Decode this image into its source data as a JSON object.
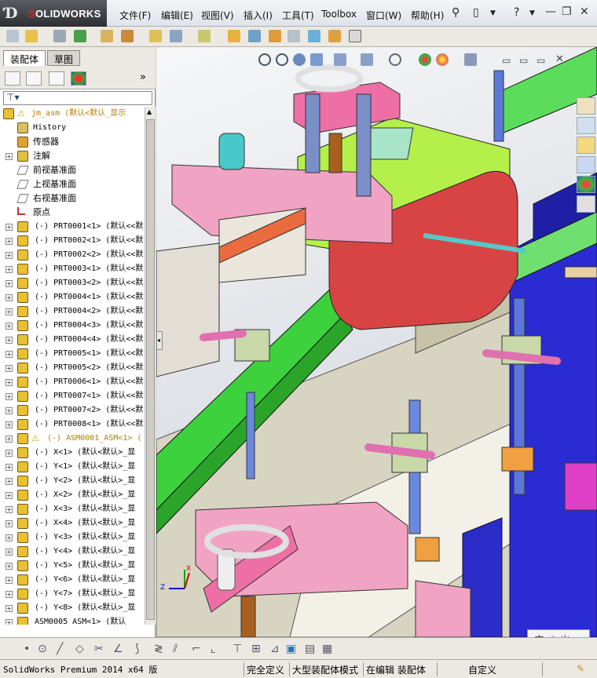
{
  "app": {
    "brand": "SOLIDWORKS",
    "menu": [
      "文件(F)",
      "编辑(E)",
      "视图(V)",
      "插入(I)",
      "工具(T)",
      "Toolbox",
      "窗口(W)",
      "帮助(H)"
    ],
    "accent": "#d42a2a"
  },
  "panel": {
    "tabs": [
      "装配体",
      "草图"
    ],
    "expand_label": "»"
  },
  "tree": {
    "root": "jm_asm  (默认<默认_显示",
    "items": [
      {
        "label": "History",
        "kind": "history"
      },
      {
        "label": "传感器",
        "kind": "sensor"
      },
      {
        "label": "注解",
        "kind": "annotation"
      },
      {
        "label": "前视基准面",
        "kind": "plane"
      },
      {
        "label": "上视基准面",
        "kind": "plane"
      },
      {
        "label": "右视基准面",
        "kind": "plane"
      },
      {
        "label": "原点",
        "kind": "origin"
      },
      {
        "label": "(-) PRT0001<1> (默认<<默",
        "kind": "part"
      },
      {
        "label": "(-) PRT0002<1> (默认<<默",
        "kind": "part"
      },
      {
        "label": "(-) PRT0002<2> (默认<<默",
        "kind": "part"
      },
      {
        "label": "(-) PRT0003<1> (默认<<默",
        "kind": "part"
      },
      {
        "label": "(-) PRT0003<2> (默认<<默",
        "kind": "part"
      },
      {
        "label": "(-) PRT0004<1> (默认<<默",
        "kind": "part"
      },
      {
        "label": "(-) PRT0004<2> (默认<<默",
        "kind": "part"
      },
      {
        "label": "(-) PRT0004<3> (默认<<默",
        "kind": "part"
      },
      {
        "label": "(-) PRT0004<4> (默认<<默",
        "kind": "part"
      },
      {
        "label": "(-) PRT0005<1> (默认<<默",
        "kind": "part"
      },
      {
        "label": "(-) PRT0005<2> (默认<<默",
        "kind": "part"
      },
      {
        "label": "(-) PRT0006<1> (默认<<默",
        "kind": "part"
      },
      {
        "label": "(-) PRT0007<1> (默认<<默",
        "kind": "part"
      },
      {
        "label": "(-) PRT0007<2> (默认<<默",
        "kind": "part"
      },
      {
        "label": "(-) PRT0008<1> (默认<<默",
        "kind": "part"
      },
      {
        "label": "(-) ASM0001_ASM<1> (",
        "kind": "subasm"
      },
      {
        "label": "(-) X<1> (默认<默认>_显",
        "kind": "part"
      },
      {
        "label": "(-) Y<1> (默认<默认>_显",
        "kind": "part"
      },
      {
        "label": "(-) Y<2> (默认<默认>_显",
        "kind": "part"
      },
      {
        "label": "(-) X<2> (默认<默认>_显",
        "kind": "part"
      },
      {
        "label": "(-) X<3> (默认<默认>_显",
        "kind": "part"
      },
      {
        "label": "(-) X<4> (默认<默认>_显",
        "kind": "part"
      },
      {
        "label": "(-) Y<3> (默认<默认>_显",
        "kind": "part"
      },
      {
        "label": "(-) Y<4> (默认<默认>_显",
        "kind": "part"
      },
      {
        "label": "(-) Y<5> (默认<默认>_显",
        "kind": "part"
      },
      {
        "label": "(-) Y<6> (默认<默认>_显",
        "kind": "part"
      },
      {
        "label": "(-) Y<7> (默认<默认>_显",
        "kind": "part"
      },
      {
        "label": "(-) Y<8> (默认<默认>_显",
        "kind": "part"
      },
      {
        "label": "ASM0005_ASM<1> (默认",
        "kind": "asm"
      }
    ]
  },
  "viewport": {
    "triad": {
      "x": "X",
      "y": "Y",
      "z": "Z"
    },
    "ime": "中 ☽ ㄓ"
  },
  "status": {
    "product": "SolidWorks Premium 2014 x64 版",
    "underdefined": "完全定义",
    "large_mode": "大型装配体模式",
    "editing": "在编辑 装配体",
    "custom": "自定义"
  }
}
